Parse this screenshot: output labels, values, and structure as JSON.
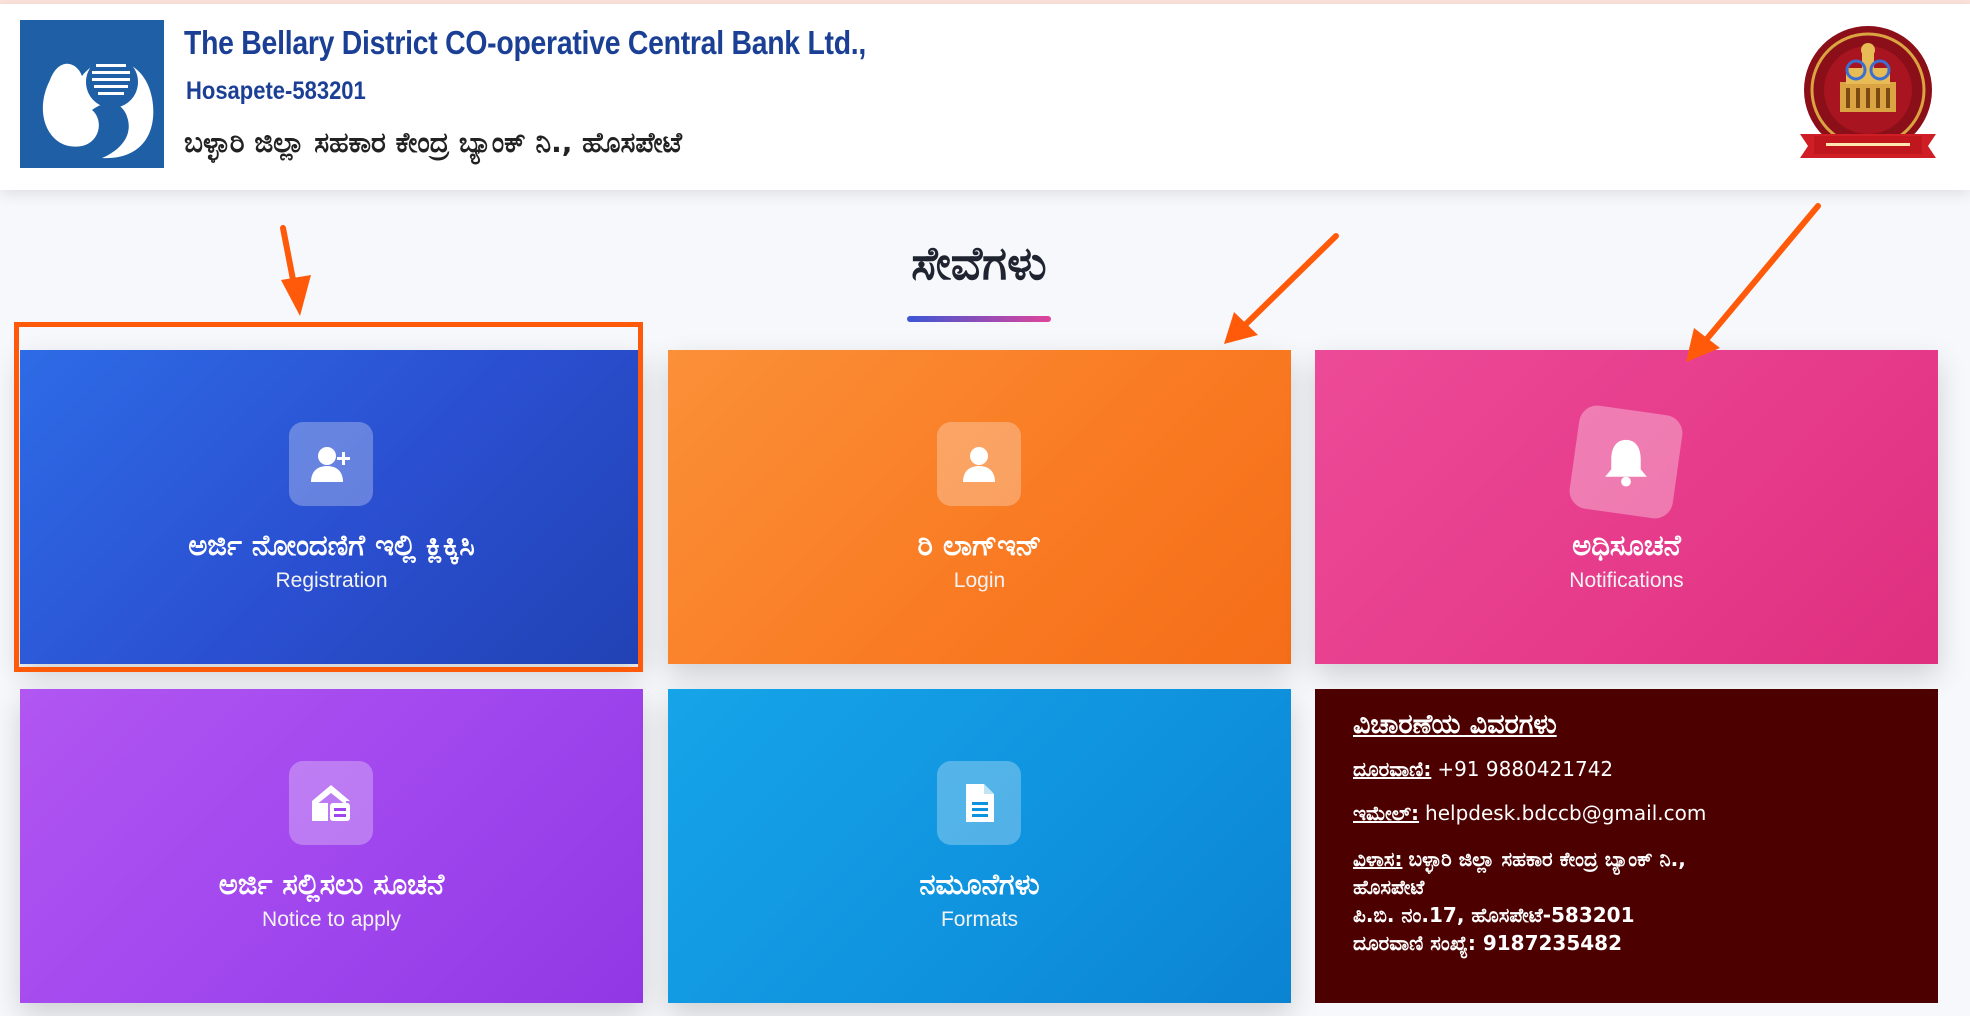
{
  "header": {
    "title": "The Bellary District CO-operative Central Bank Ltd.,",
    "city": "Hosapete-583201",
    "title_kannada": "ಬಳ್ಳಾರಿ ಜಿಲ್ಲಾ ಸಹಕಾರ ಕೇಂದ್ರ ಬ್ಯಾಂಕ್ ನಿ., ಹೊಸಪೇಟೆ"
  },
  "section": {
    "title": "ಸೇವೆಗಳು"
  },
  "cards": [
    {
      "label_kn": "ಅರ್ಜಿ ನೋಂದಣಿಗೆ ಇಲ್ಲಿ ಕ್ಲಿಕ್ಕಿಸಿ",
      "label_en": "Registration",
      "icon": "user-plus-icon",
      "color": "#2a4fd0"
    },
    {
      "label_kn": "ರಿ ಲಾಗ್ಇನ್",
      "label_en": "Login",
      "icon": "user-icon",
      "color": "#f97a22"
    },
    {
      "label_kn": "ಅಧಿಸೂಚನೆ",
      "label_en": "Notifications",
      "icon": "bell-icon",
      "color": "#e63a8a"
    },
    {
      "label_kn": "ಅರ್ಜಿ ಸಲ್ಲಿಸಲು ಸೂಚನೆ",
      "label_en": "Notice to apply",
      "icon": "house-notice-icon",
      "color": "#a046ee"
    },
    {
      "label_kn": "ನಮೂನೆಗಳು",
      "label_en": "Formats",
      "icon": "document-icon",
      "color": "#0f92de"
    }
  ],
  "contact": {
    "title": "ವಿಚಾರಣೆಯ ವಿವರಗಳು",
    "phone_label": "ದೂರವಾಣಿ:",
    "phone": "+91 9880421742",
    "email_label": "ಇಮೇಲ್:",
    "email": "helpdesk.bdccb@gmail.com",
    "address_label": "ವಿಳಾಸ:",
    "address_line1": "ಬಳ್ಳಾರಿ ಜಿಲ್ಲಾ ಸಹಕಾರ ಕೇಂದ್ರ ಬ್ಯಾಂಕ್ ನಿ.,",
    "address_line2": "ಹೊಸಪೇಟೆ",
    "address_line3": "ಪಿ.ಬಿ. ನಂ.17, ಹೊಸಪೇಟೆ-583201",
    "address_line4": "ದೂರವಾಣಿ ಸಂಖ್ಯೆ: 9187235482",
    "background": "#4d0000"
  },
  "annotations": {
    "highlight_color": "#ff5a0a"
  }
}
